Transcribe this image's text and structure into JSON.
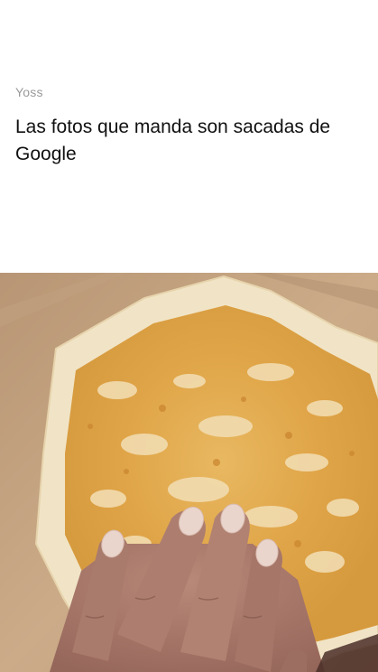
{
  "post": {
    "author": "Yoss",
    "text": "Las fotos que manda son sacadas de Google"
  },
  "image": {
    "subject": "food-photo",
    "colors": {
      "background": "#c7a887",
      "tortilla": "#f3e7cc",
      "toasted": "#e2a94a",
      "skin": "#a8786a",
      "nails": "#e9d3cc"
    }
  }
}
